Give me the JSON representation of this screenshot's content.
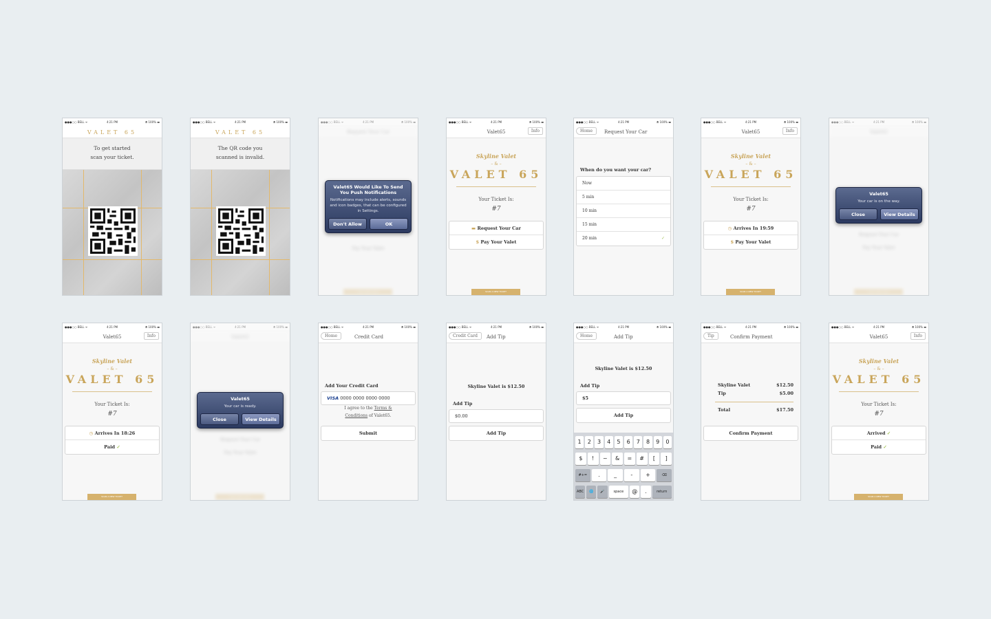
{
  "status": {
    "carrier": "●●●○○ BELL ᯤ",
    "time": "4:21 PM",
    "battery": "⦾ 100% ▬"
  },
  "brand": {
    "logo": "VALET 65",
    "skyline": "Skyline Valet",
    "amp": "– & –",
    "v65": "VALET 65",
    "app_name": "Valet65"
  },
  "nav": {
    "info": "Info",
    "home": "Home",
    "credit_card": "Credit Card",
    "tip": "Tip",
    "request_title": "Request Your Car",
    "cc_title": "Credit Card",
    "add_tip_title": "Add Tip",
    "confirm_title": "Confirm Payment"
  },
  "scan": {
    "intro_line1": "To get started",
    "intro_line2": "scan your ticket.",
    "invalid_line1": "The QR code you",
    "invalid_line2": "scanned is invalid."
  },
  "ticket": {
    "label": "Your Ticket Is:",
    "number": "#7"
  },
  "actions": {
    "request": "Request Your Car",
    "pay": "Pay Your Valet",
    "arrives_1": "Arrives In 19:59",
    "arrives_2": "Arrives In 18:26",
    "paid": "Paid",
    "arrived": "Arrived"
  },
  "footer": "SCAN A NEW TICKET",
  "push": {
    "title": "Valet65 Would Like To Send You Push Notifications",
    "message": "Notifications may include alerts, sounds and icon badges, that can be configured in Settings.",
    "deny": "Don't Allow",
    "ok": "OK"
  },
  "alerts": {
    "title": "Valet65",
    "on_way": "Your car is on the way.",
    "ready": "Your car is ready.",
    "close": "Close",
    "details": "View Details"
  },
  "request": {
    "question": "When do you want your car?",
    "options": [
      "Now",
      "5 min",
      "10 min",
      "15 min",
      "20 min"
    ],
    "selected": "20 min"
  },
  "card": {
    "heading": "Add Your Credit Card",
    "brand": "VISA",
    "number": "0000 0000 0000 0000",
    "terms_pre": "I agree to the",
    "terms_link": "Terms &",
    "terms_link2": "Conditions",
    "terms_post": "of Valet65.",
    "submit": "Submit"
  },
  "tip": {
    "summary": "Skyline Valet is $12.50",
    "label": "Add Tip",
    "empty": "$0.00",
    "entered": "$5",
    "button": "Add Tip"
  },
  "keyboard": {
    "row1": [
      "1",
      "2",
      "3",
      "4",
      "5",
      "6",
      "7",
      "8",
      "9",
      "0"
    ],
    "row2": [
      "$",
      "!",
      "~",
      "&",
      "=",
      "#",
      "[",
      "]"
    ],
    "row3": [
      "#+=",
      ".",
      "_",
      "-",
      "+",
      "⌫"
    ],
    "row4": [
      "ABC",
      "🌐",
      "🎤",
      "space",
      "@",
      ".",
      "return"
    ]
  },
  "confirm": {
    "valet": "Skyline Valet",
    "valet_amt": "$12.50",
    "tip": "Tip",
    "tip_amt": "$5.00",
    "total": "Total",
    "total_amt": "$17.50",
    "button": "Confirm Payment"
  }
}
